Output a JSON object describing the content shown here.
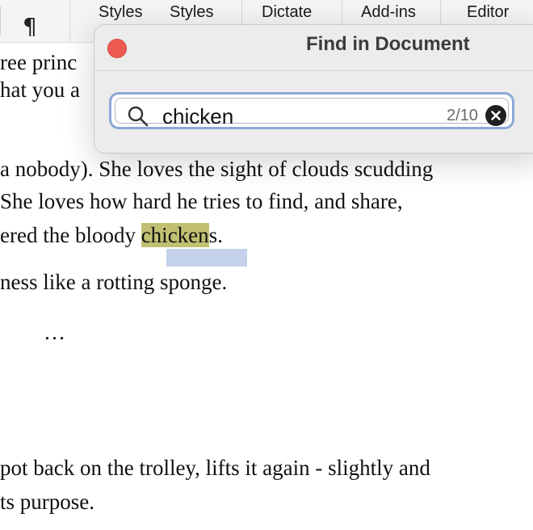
{
  "ribbon": {
    "pilcrow": "¶",
    "labels": [
      "Styles",
      "Styles",
      "Dictate",
      "Add-ins",
      "Editor"
    ]
  },
  "document": {
    "lines": [
      "ree princ",
      "hat you a",
      " a nobody). She loves the sight of clouds scudding",
      "She loves how hard he tries to find, and share,",
      "ered the bloody ",
      "chicken",
      "s.",
      "ness like a rotting sponge.",
      "…",
      "pot back on the trolley, lifts it again - slightly and",
      "ts purpose."
    ]
  },
  "find_dialog": {
    "title": "Find in Document",
    "query": "chicken",
    "match_count": "2/10"
  },
  "colors": {
    "highlight": "#c1c072",
    "selection": "#c3d2ea",
    "close": "#ee5a52",
    "focus_ring": "#8ba8d8"
  }
}
